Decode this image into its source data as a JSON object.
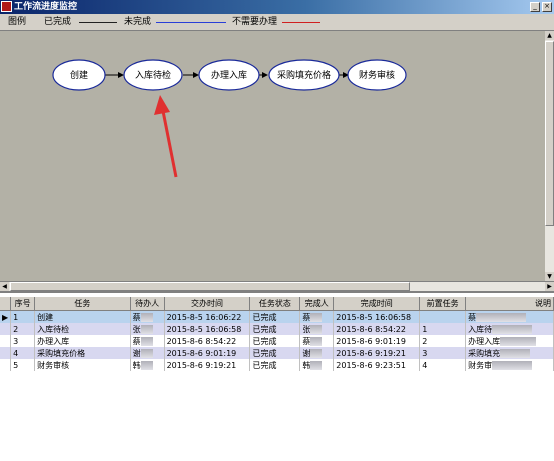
{
  "window": {
    "title": "工作流进度监控"
  },
  "legend": {
    "label": "图例",
    "items": [
      {
        "label": "已完成",
        "color": "#222222"
      },
      {
        "label": "未完成",
        "color": "#2a3fd8"
      },
      {
        "label": "不需要办理",
        "color": "#d02020"
      }
    ]
  },
  "flow": {
    "nodes": [
      {
        "label": "创建"
      },
      {
        "label": "入库待检"
      },
      {
        "label": "办理入库"
      },
      {
        "label": "采购填充价格"
      },
      {
        "label": "财务审核"
      }
    ],
    "edge_color": "#000000",
    "annotation_color": "#e03030"
  },
  "table": {
    "columns": [
      "序号",
      "任务",
      "待办人",
      "交办时间",
      "任务状态",
      "完成人",
      "完成时间",
      "前置任务",
      "说明"
    ],
    "rows": [
      [
        "1",
        "创建",
        "蔡",
        "2015-8-5 16:06:22",
        "已完成",
        "蔡",
        "2015-8-5 16:06:58",
        "",
        "蔡"
      ],
      [
        "2",
        "入库待检",
        "张",
        "2015-8-5 16:06:58",
        "已完成",
        "张",
        "2015-8-6 8:54:22",
        "1",
        "入库待"
      ],
      [
        "3",
        "办理入库",
        "蔡",
        "2015-8-6 8:54:22",
        "已完成",
        "蔡",
        "2015-8-6 9:01:19",
        "2",
        "办理入库"
      ],
      [
        "4",
        "采购填充价格",
        "谢",
        "2015-8-6 9:01:19",
        "已完成",
        "谢",
        "2015-8-6 9:19:21",
        "3",
        "采购填充"
      ],
      [
        "5",
        "财务审核",
        "韩",
        "2015-8-6 9:19:21",
        "已完成",
        "韩",
        "2015-8-6 9:23:51",
        "4",
        "财务审"
      ]
    ]
  }
}
